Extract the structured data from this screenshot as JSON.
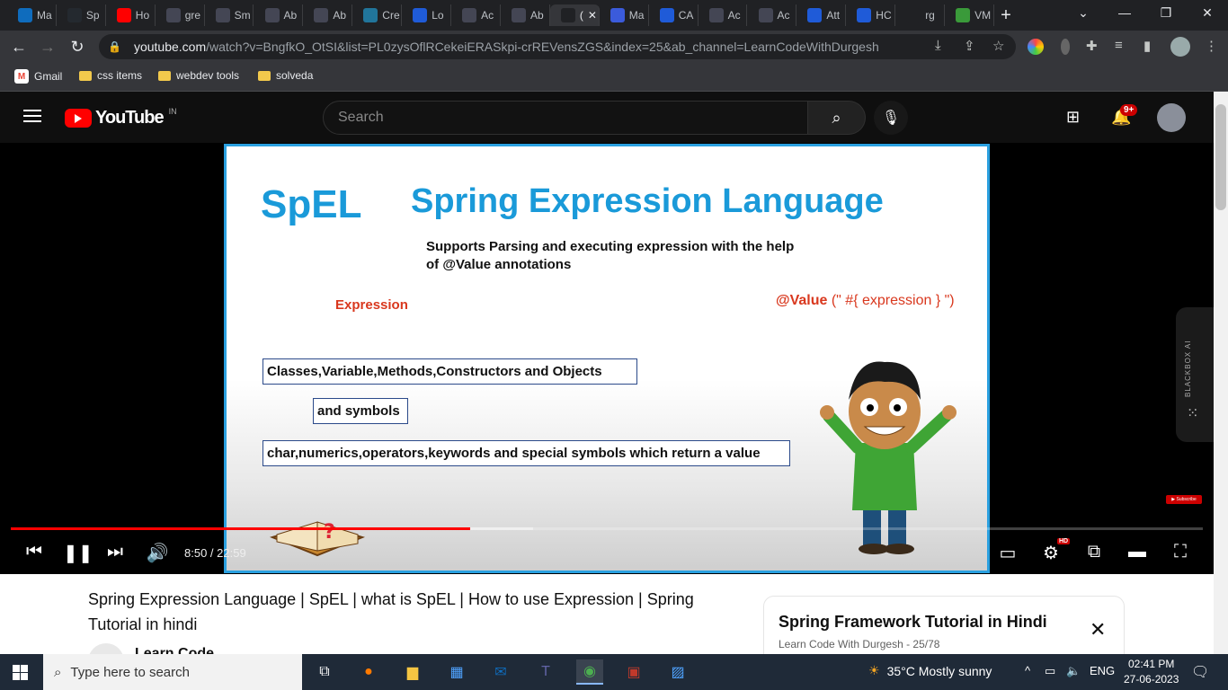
{
  "browser": {
    "tabs": [
      {
        "label": "Ma",
        "icon": "outlook-icon",
        "color": "#0f6cbd"
      },
      {
        "label": "Sp",
        "icon": "github-icon",
        "color": "#24292f"
      },
      {
        "label": "Ho",
        "icon": "youtube-icon",
        "color": "#ff0000"
      },
      {
        "label": "gre",
        "icon": "chatgpt-icon",
        "color": "#444654"
      },
      {
        "label": "Sm",
        "icon": "chatgpt-icon",
        "color": "#444654"
      },
      {
        "label": "Ab",
        "icon": "chatgpt-icon",
        "color": "#444654"
      },
      {
        "label": "Ab",
        "icon": "chatgpt-icon",
        "color": "#444654"
      },
      {
        "label": "Cre",
        "icon": "wordpress-icon",
        "color": "#21759b"
      },
      {
        "label": "Lo",
        "icon": "devops-icon",
        "color": "#1f5bd8"
      },
      {
        "label": "Ac",
        "icon": "chatgpt-icon",
        "color": "#444654"
      },
      {
        "label": "Ab",
        "icon": "chatgpt-icon",
        "color": "#444654"
      },
      {
        "label": "(",
        "icon": "audio-icon",
        "color": "#202124",
        "active": true
      },
      {
        "label": "Ma",
        "icon": "mail-icon",
        "color": "#3b5bdb"
      },
      {
        "label": "CA",
        "icon": "devops-icon",
        "color": "#1f5bd8"
      },
      {
        "label": "Ac",
        "icon": "chatgpt-icon",
        "color": "#444654"
      },
      {
        "label": "Ac",
        "icon": "chatgpt-icon",
        "color": "#444654"
      },
      {
        "label": "Att",
        "icon": "devops-icon",
        "color": "#1f5bd8"
      },
      {
        "label": "HC",
        "icon": "devops-icon",
        "color": "#1f5bd8"
      },
      {
        "label": "rg",
        "icon": "loading-icon",
        "color": "#202124"
      },
      {
        "label": "VM",
        "icon": "vm-icon",
        "color": "#3a9a3a"
      }
    ],
    "url_host": "youtube.com",
    "url_rest": "/watch?v=BngfkO_OtSI&list=PL0zysOflRCekeiERASkpi-crREVensZGS&index=25&ab_channel=LearnCodeWithDurgesh",
    "bookmarks": [
      "Gmail",
      "css items",
      "webdev tools",
      "solveda"
    ]
  },
  "youtube": {
    "region": "IN",
    "search_placeholder": "Search",
    "notification_count": "9+",
    "slide": {
      "abbr": "SpEL",
      "title": "Spring Expression Language",
      "support_text": "Supports Parsing and executing expression with the help of @Value annotations",
      "expression_label": "Expression",
      "value_prefix": "@Value",
      "value_rest": " (\" #{ expression } \")",
      "box1": "Classes,Variable,Methods,Constructors and Objects",
      "box2": "and symbols",
      "box3": "char,numerics,operators,keywords and special symbols which return a value"
    },
    "player": {
      "time": "8:50 / 22:59",
      "progress_fraction": 0.385,
      "buffered_fraction": 0.438,
      "hd_badge": "HD",
      "blackbox_label": "BLACKBOX AI"
    },
    "video_title": "Spring Expression Language | SpEL | what is SpEL | How to use Expression | Spring Tutorial in hindi",
    "channel_name": "Learn Code",
    "playlist": {
      "title": "Spring Framework Tutorial in Hindi",
      "subtitle": "Learn Code With Durgesh - 25/78"
    }
  },
  "taskbar": {
    "search_placeholder": "Type here to search",
    "weather": "35°C  Mostly sunny",
    "lang": "ENG",
    "time": "02:41 PM",
    "date": "27-06-2023"
  }
}
